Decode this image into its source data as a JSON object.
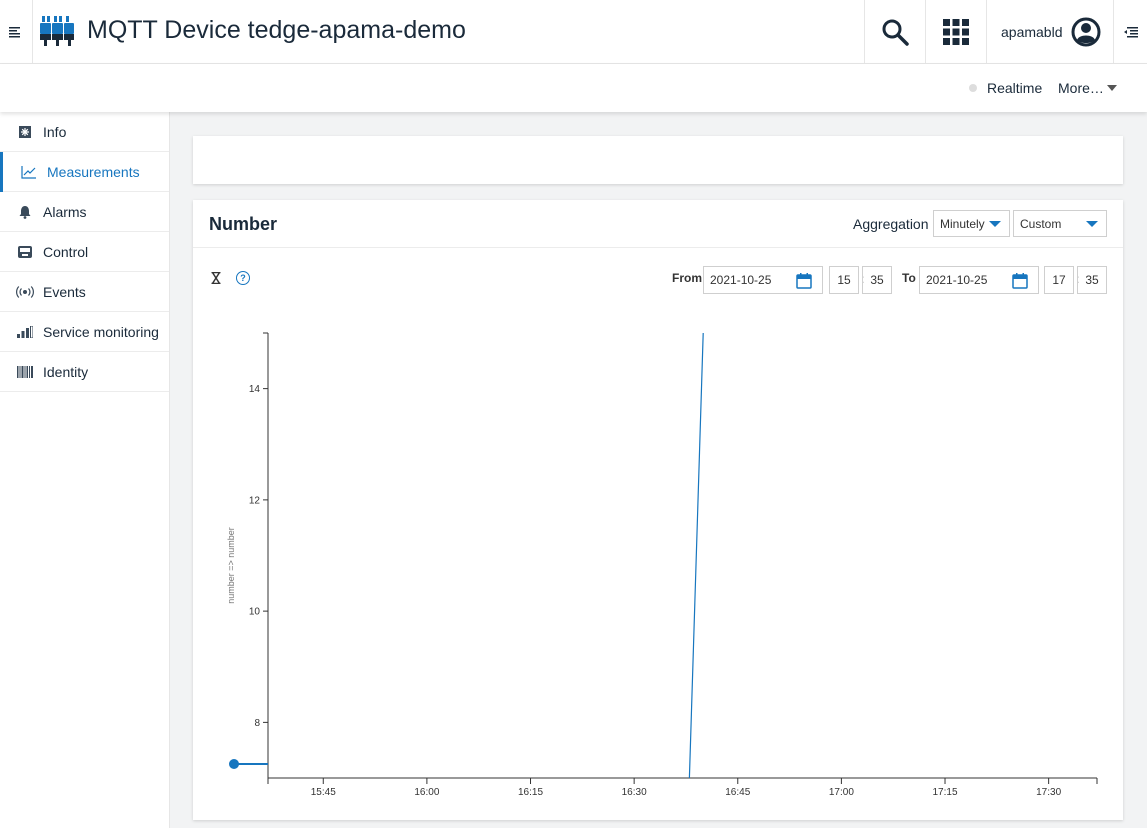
{
  "header": {
    "title": "MQTT Device tedge-apama-demo",
    "username": "apamabld",
    "icons": [
      "menu-icon",
      "device-icon",
      "search-icon",
      "app-switcher-icon",
      "user-icon",
      "right-drawer-icon"
    ]
  },
  "actionbar": {
    "realtime_label": "Realtime",
    "more_label": "More…"
  },
  "sidebar": {
    "items": [
      {
        "label": "Info",
        "icon": "info-icon"
      },
      {
        "label": "Measurements",
        "icon": "line-chart-icon",
        "active": true
      },
      {
        "label": "Alarms",
        "icon": "bell-icon"
      },
      {
        "label": "Control",
        "icon": "control-icon"
      },
      {
        "label": "Events",
        "icon": "signal-icon"
      },
      {
        "label": "Service monitoring",
        "icon": "bar-chart-icon"
      },
      {
        "label": "Identity",
        "icon": "barcode-icon"
      }
    ]
  },
  "measurement": {
    "title": "Number",
    "aggregation_label": "Aggregation",
    "aggregation_value": "Minutely",
    "interval_value": "Custom",
    "from_label": "From",
    "from_date": "2021-10-25",
    "from_hour": "15",
    "from_minute": "35",
    "to_label": "To",
    "to_date": "2021-10-25",
    "to_hour": "17",
    "to_minute": "35",
    "help_glyph": "?"
  },
  "colors": {
    "accent": "#1776bf",
    "title": "#1a2a3a",
    "background": "#f2f3f4"
  },
  "chart_data": {
    "type": "line",
    "ylabel": "number => number",
    "xlabel": "",
    "x_ticks": [
      "15:45",
      "16:00",
      "16:15",
      "16:30",
      "16:45",
      "17:00",
      "17:15",
      "17:30"
    ],
    "y_ticks": [
      8,
      10,
      12,
      14
    ],
    "ylim": [
      7,
      15
    ],
    "xlim": [
      "15:37",
      "17:37"
    ],
    "series": [
      {
        "points": [
          {
            "x": "16:38",
            "y": 7
          },
          {
            "x": "16:40",
            "y": 15
          }
        ]
      }
    ],
    "legend_marker": "line-with-dot",
    "grid": false
  }
}
